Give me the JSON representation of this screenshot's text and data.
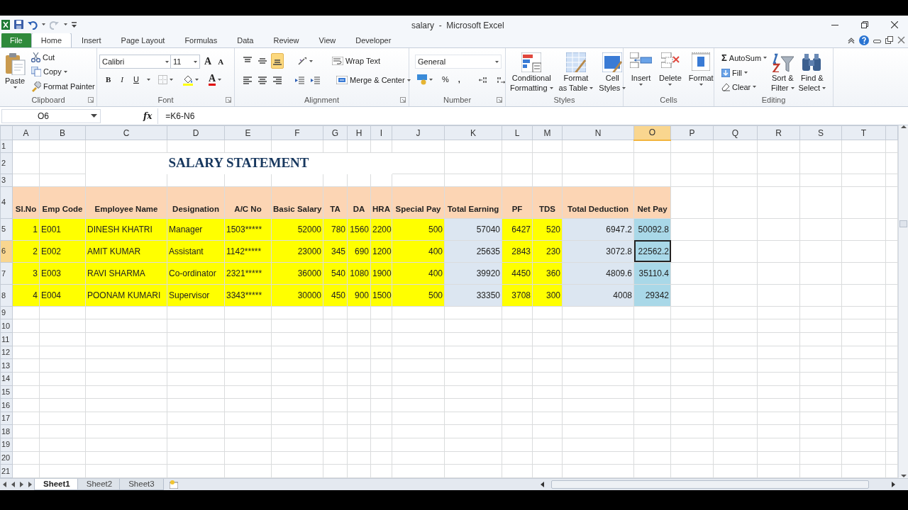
{
  "window": {
    "title": "salary  -  Microsoft Excel"
  },
  "tabs": [
    {
      "label": "File",
      "kind": "file",
      "selected": false
    },
    {
      "label": "Home",
      "kind": "tab",
      "selected": true
    },
    {
      "label": "Insert",
      "kind": "tab",
      "selected": false
    },
    {
      "label": "Page Layout",
      "kind": "tab",
      "selected": false
    },
    {
      "label": "Formulas",
      "kind": "tab",
      "selected": false
    },
    {
      "label": "Data",
      "kind": "tab",
      "selected": false
    },
    {
      "label": "Review",
      "kind": "tab",
      "selected": false
    },
    {
      "label": "View",
      "kind": "tab",
      "selected": false
    },
    {
      "label": "Developer",
      "kind": "tab",
      "selected": false
    }
  ],
  "ribbon": {
    "clipboard": {
      "label": "Clipboard",
      "paste": "Paste",
      "items": [
        "Cut",
        "Copy",
        "Format Painter"
      ]
    },
    "font": {
      "label": "Font",
      "font_name": "Calibri",
      "font_size": "11",
      "grow": "A",
      "shrink": "A",
      "bold": "B",
      "italic": "I",
      "underline": "U",
      "font_color": "A"
    },
    "alignment": {
      "label": "Alignment",
      "vertical_align": [
        {
          "selected": false
        },
        {
          "selected": false
        },
        {
          "selected": true
        }
      ],
      "wrap_text": "Wrap Text",
      "merge": "Merge & Center"
    },
    "number": {
      "label": "Number",
      "format": "General",
      "percent": "%",
      "comma": ","
    },
    "styles": {
      "label": "Styles",
      "buttons": [
        {
          "lines": [
            "Conditional",
            "Formatting"
          ]
        },
        {
          "lines": [
            "Format",
            "as Table"
          ]
        },
        {
          "lines": [
            "Cell",
            "Styles"
          ]
        }
      ]
    },
    "cells": {
      "label": "Cells",
      "buttons": [
        "Insert",
        "Delete",
        "Format"
      ]
    },
    "editing": {
      "label": "Editing",
      "autosum_symbol": "Σ",
      "items": [
        "AutoSum",
        "Fill",
        "Clear"
      ],
      "buttons": [
        {
          "lines": [
            "Sort &",
            "Filter"
          ]
        },
        {
          "lines": [
            "Find &",
            "Select"
          ]
        }
      ]
    }
  },
  "formula_bar": {
    "name_box": "O6",
    "function_label": "fx",
    "formula": "=K6-N6"
  },
  "sheet": {
    "columns": [
      {
        "label": "A",
        "selected": false
      },
      {
        "label": "B",
        "selected": false
      },
      {
        "label": "C",
        "selected": false
      },
      {
        "label": "D",
        "selected": false
      },
      {
        "label": "E",
        "selected": false
      },
      {
        "label": "F",
        "selected": false
      },
      {
        "label": "G",
        "selected": false
      },
      {
        "label": "H",
        "selected": false
      },
      {
        "label": "I",
        "selected": false
      },
      {
        "label": "J",
        "selected": false
      },
      {
        "label": "K",
        "selected": false
      },
      {
        "label": "L",
        "selected": false
      },
      {
        "label": "M",
        "selected": false
      },
      {
        "label": "N",
        "selected": false
      },
      {
        "label": "O",
        "selected": true
      },
      {
        "label": "P",
        "selected": false
      },
      {
        "label": "Q",
        "selected": false
      },
      {
        "label": "R",
        "selected": false
      },
      {
        "label": "S",
        "selected": false
      },
      {
        "label": "T",
        "selected": false
      }
    ],
    "rows": [
      {
        "number": "1",
        "selected": false
      },
      {
        "number": "2",
        "selected": false,
        "title": "SALARY STATEMENT"
      },
      {
        "number": "3",
        "selected": false
      },
      {
        "number": "4",
        "selected": false,
        "kind": "header",
        "cells": [
          {
            "text": "Sl.No",
            "color": "#fcd5b4"
          },
          {
            "text": "Emp Code",
            "color": "#fcd5b4"
          },
          {
            "text": "Employee Name",
            "color": "#fcd5b4"
          },
          {
            "text": "Designation",
            "color": "#fcd5b4"
          },
          {
            "text": "A/C No",
            "color": "#fcd5b4"
          },
          {
            "text": "Basic Salary",
            "color": "#fcd5b4"
          },
          {
            "text": "TA",
            "color": "#fcd5b4"
          },
          {
            "text": "DA",
            "color": "#fcd5b4"
          },
          {
            "text": "HRA",
            "color": "#fcd5b4"
          },
          {
            "text": "Special Pay",
            "color": "#fcd5b4"
          },
          {
            "text": "Total Earning",
            "color": "#fcd5b4"
          },
          {
            "text": "PF",
            "color": "#fcd5b4"
          },
          {
            "text": "TDS",
            "color": "#fcd5b4"
          },
          {
            "text": "Total Deduction",
            "color": "#fcd5b4"
          },
          {
            "text": "Net Pay",
            "color": "#fcd5b4"
          }
        ]
      },
      {
        "number": "5",
        "selected": false,
        "kind": "data",
        "cells": [
          {
            "text": "1",
            "color": "#ffff00",
            "kind": "number",
            "selected": false
          },
          {
            "text": "E001",
            "color": "#ffff00",
            "kind": "text",
            "selected": false
          },
          {
            "text": "DINESH KHATRI",
            "color": "#ffff00",
            "kind": "text",
            "selected": false
          },
          {
            "text": "Manager",
            "color": "#ffff00",
            "kind": "text",
            "selected": false
          },
          {
            "text": "1503*****",
            "color": "#ffff00",
            "kind": "text",
            "selected": false
          },
          {
            "text": "52000",
            "color": "#ffff00",
            "kind": "number",
            "selected": false
          },
          {
            "text": "780",
            "color": "#ffff00",
            "kind": "number",
            "selected": false
          },
          {
            "text": "1560",
            "color": "#ffff00",
            "kind": "number",
            "selected": false
          },
          {
            "text": "2200",
            "color": "#ffff00",
            "kind": "number",
            "selected": false
          },
          {
            "text": "500",
            "color": "#ffff00",
            "kind": "number",
            "selected": false
          },
          {
            "text": "57040",
            "color": "#dce6f1",
            "kind": "number",
            "selected": false
          },
          {
            "text": "6427",
            "color": "#ffff00",
            "kind": "number",
            "selected": false
          },
          {
            "text": "520",
            "color": "#ffff00",
            "kind": "number",
            "selected": false
          },
          {
            "text": "6947.2",
            "color": "#dce6f1",
            "kind": "number",
            "selected": false
          },
          {
            "text": "50092.8",
            "color": "#a9d8e8",
            "kind": "number",
            "selected": false
          }
        ]
      },
      {
        "number": "6",
        "selected": true,
        "kind": "data",
        "cells": [
          {
            "text": "2",
            "color": "#ffff00",
            "kind": "number",
            "selected": false
          },
          {
            "text": "E002",
            "color": "#ffff00",
            "kind": "text",
            "selected": false
          },
          {
            "text": "AMIT KUMAR",
            "color": "#ffff00",
            "kind": "text",
            "selected": false
          },
          {
            "text": "Assistant",
            "color": "#ffff00",
            "kind": "text",
            "selected": false
          },
          {
            "text": "1142*****",
            "color": "#ffff00",
            "kind": "text",
            "selected": false
          },
          {
            "text": "23000",
            "color": "#ffff00",
            "kind": "number",
            "selected": false
          },
          {
            "text": "345",
            "color": "#ffff00",
            "kind": "number",
            "selected": false
          },
          {
            "text": "690",
            "color": "#ffff00",
            "kind": "number",
            "selected": false
          },
          {
            "text": "1200",
            "color": "#ffff00",
            "kind": "number",
            "selected": false
          },
          {
            "text": "400",
            "color": "#ffff00",
            "kind": "number",
            "selected": false
          },
          {
            "text": "25635",
            "color": "#dce6f1",
            "kind": "number",
            "selected": false
          },
          {
            "text": "2843",
            "color": "#ffff00",
            "kind": "number",
            "selected": false
          },
          {
            "text": "230",
            "color": "#ffff00",
            "kind": "number",
            "selected": false
          },
          {
            "text": "3072.8",
            "color": "#dce6f1",
            "kind": "number",
            "selected": false
          },
          {
            "text": "22562.2",
            "color": "#a9d8e8",
            "kind": "number",
            "selected": true
          }
        ]
      },
      {
        "number": "7",
        "selected": false,
        "kind": "data",
        "cells": [
          {
            "text": "3",
            "color": "#ffff00",
            "kind": "number",
            "selected": false
          },
          {
            "text": "E003",
            "color": "#ffff00",
            "kind": "text",
            "selected": false
          },
          {
            "text": "RAVI SHARMA",
            "color": "#ffff00",
            "kind": "text",
            "selected": false
          },
          {
            "text": "Co-ordinator",
            "color": "#ffff00",
            "kind": "text",
            "selected": false
          },
          {
            "text": "2321*****",
            "color": "#ffff00",
            "kind": "text",
            "selected": false
          },
          {
            "text": "36000",
            "color": "#ffff00",
            "kind": "number",
            "selected": false
          },
          {
            "text": "540",
            "color": "#ffff00",
            "kind": "number",
            "selected": false
          },
          {
            "text": "1080",
            "color": "#ffff00",
            "kind": "number",
            "selected": false
          },
          {
            "text": "1900",
            "color": "#ffff00",
            "kind": "number",
            "selected": false
          },
          {
            "text": "400",
            "color": "#ffff00",
            "kind": "number",
            "selected": false
          },
          {
            "text": "39920",
            "color": "#dce6f1",
            "kind": "number",
            "selected": false
          },
          {
            "text": "4450",
            "color": "#ffff00",
            "kind": "number",
            "selected": false
          },
          {
            "text": "360",
            "color": "#ffff00",
            "kind": "number",
            "selected": false
          },
          {
            "text": "4809.6",
            "color": "#dce6f1",
            "kind": "number",
            "selected": false
          },
          {
            "text": "35110.4",
            "color": "#a9d8e8",
            "kind": "number",
            "selected": false
          }
        ]
      },
      {
        "number": "8",
        "selected": false,
        "kind": "data",
        "cells": [
          {
            "text": "4",
            "color": "#ffff00",
            "kind": "number",
            "selected": false
          },
          {
            "text": "E004",
            "color": "#ffff00",
            "kind": "text",
            "selected": false
          },
          {
            "text": "POONAM KUMARI",
            "color": "#ffff00",
            "kind": "text",
            "selected": false
          },
          {
            "text": "Supervisor",
            "color": "#ffff00",
            "kind": "text",
            "selected": false
          },
          {
            "text": "3343*****",
            "color": "#ffff00",
            "kind": "text",
            "selected": false
          },
          {
            "text": "30000",
            "color": "#ffff00",
            "kind": "number",
            "selected": false
          },
          {
            "text": "450",
            "color": "#ffff00",
            "kind": "number",
            "selected": false
          },
          {
            "text": "900",
            "color": "#ffff00",
            "kind": "number",
            "selected": false
          },
          {
            "text": "1500",
            "color": "#ffff00",
            "kind": "number",
            "selected": false
          },
          {
            "text": "500",
            "color": "#ffff00",
            "kind": "number",
            "selected": false
          },
          {
            "text": "33350",
            "color": "#dce6f1",
            "kind": "number",
            "selected": false
          },
          {
            "text": "3708",
            "color": "#ffff00",
            "kind": "number",
            "selected": false
          },
          {
            "text": "300",
            "color": "#ffff00",
            "kind": "number",
            "selected": false
          },
          {
            "text": "4008",
            "color": "#dce6f1",
            "kind": "number",
            "selected": false
          },
          {
            "text": "29342",
            "color": "#a9d8e8",
            "kind": "number",
            "selected": false
          }
        ]
      },
      {
        "number": "9",
        "selected": false
      },
      {
        "number": "10",
        "selected": false
      },
      {
        "number": "11",
        "selected": false
      },
      {
        "number": "12",
        "selected": false
      },
      {
        "number": "13",
        "selected": false
      },
      {
        "number": "14",
        "selected": false
      },
      {
        "number": "15",
        "selected": false
      },
      {
        "number": "16",
        "selected": false
      },
      {
        "number": "17",
        "selected": false
      },
      {
        "number": "18",
        "selected": false
      },
      {
        "number": "19",
        "selected": false
      },
      {
        "number": "20",
        "selected": false
      },
      {
        "number": "21",
        "selected": false
      }
    ]
  },
  "sheet_tabs": [
    {
      "label": "Sheet1",
      "selected": true
    },
    {
      "label": "Sheet2",
      "selected": false
    },
    {
      "label": "Sheet3",
      "selected": false
    }
  ]
}
